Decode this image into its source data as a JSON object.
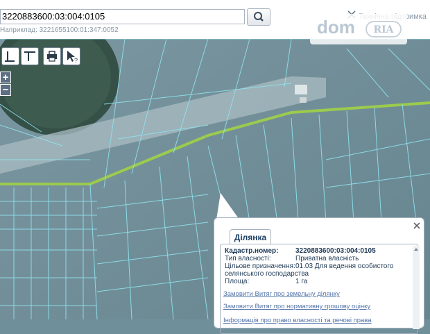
{
  "search": {
    "value": "3220883600:03:004:0105",
    "example": "Наприклад: 3221655100:01:347:0052"
  },
  "header": {
    "support_label": "Технічна підтримка"
  },
  "logo": {
    "dom": "dom",
    "ria": "RIA"
  },
  "tools": [
    {
      "icon": "measure-length-icon",
      "label": "M"
    },
    {
      "icon": "measure-area-icon",
      "label": "M²"
    },
    {
      "icon": "print-icon",
      "label": ""
    },
    {
      "icon": "info-pointer-icon",
      "label": "?"
    }
  ],
  "zoom": {
    "in": "+",
    "out": "−"
  },
  "popup": {
    "tab": "Ділянка",
    "fields": [
      {
        "label": "Кадастр.номер:",
        "value": "3220883600:03:004:0105"
      },
      {
        "label": "Тип власності:",
        "value": "Приватна власність"
      },
      {
        "label": "Цільове призначення:",
        "value": "01.03 Для ведення особистого"
      },
      {
        "label": "селянського господарства",
        "value": ""
      },
      {
        "label": "Площа:",
        "value": "1 га"
      }
    ],
    "links": [
      "Замовити Витяг про земельну ділянку",
      "Замовити Витяг про нормативну грошову оцінку",
      "Інформація про право власності та речові права"
    ]
  },
  "colors": {
    "land": "#6f8f9a",
    "parcel_line": "#8fe3f0",
    "road": "#9ccb4e",
    "popup_text": "#1f3a56",
    "link": "#5474a8"
  }
}
